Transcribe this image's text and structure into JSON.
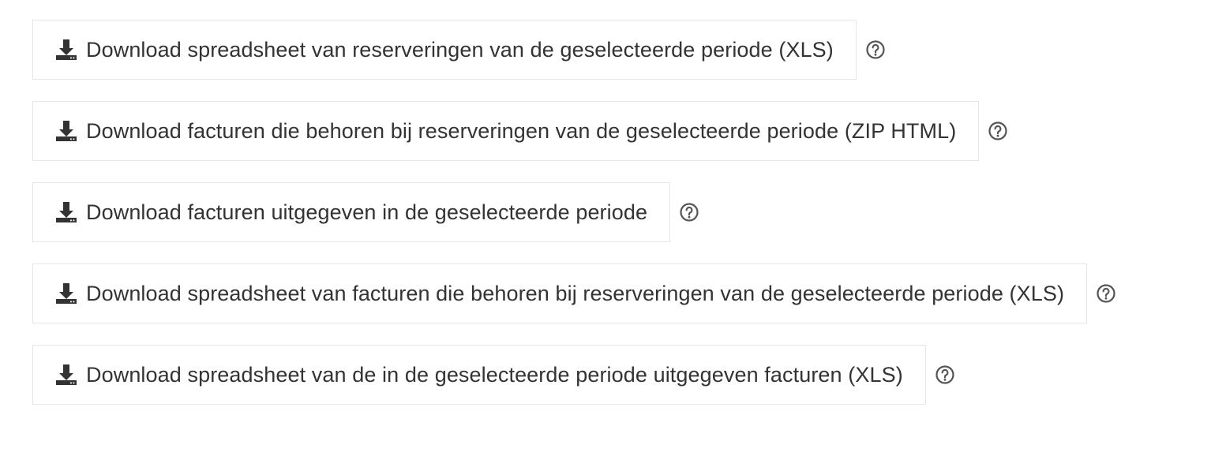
{
  "downloads": [
    {
      "label": "Download spreadsheet van reserveringen van de geselecteerde periode (XLS)",
      "icon": "download-icon",
      "help_icon": "question-circle-icon"
    },
    {
      "label": "Download facturen die behoren bij reserveringen van de geselecteerde periode (ZIP HTML)",
      "icon": "download-icon",
      "help_icon": "question-circle-icon"
    },
    {
      "label": "Download facturen uitgegeven in de geselecteerde periode",
      "icon": "download-icon",
      "help_icon": "question-circle-icon"
    },
    {
      "label": "Download spreadsheet van facturen die behoren bij reserveringen van de geselecteerde periode (XLS)",
      "icon": "download-icon",
      "help_icon": "question-circle-icon"
    },
    {
      "label": "Download spreadsheet van de in de geselecteerde periode uitgegeven facturen (XLS)",
      "icon": "download-icon",
      "help_icon": "question-circle-icon"
    }
  ],
  "colors": {
    "text": "#333333",
    "border": "#e6e6e6",
    "help_icon": "#555555"
  }
}
